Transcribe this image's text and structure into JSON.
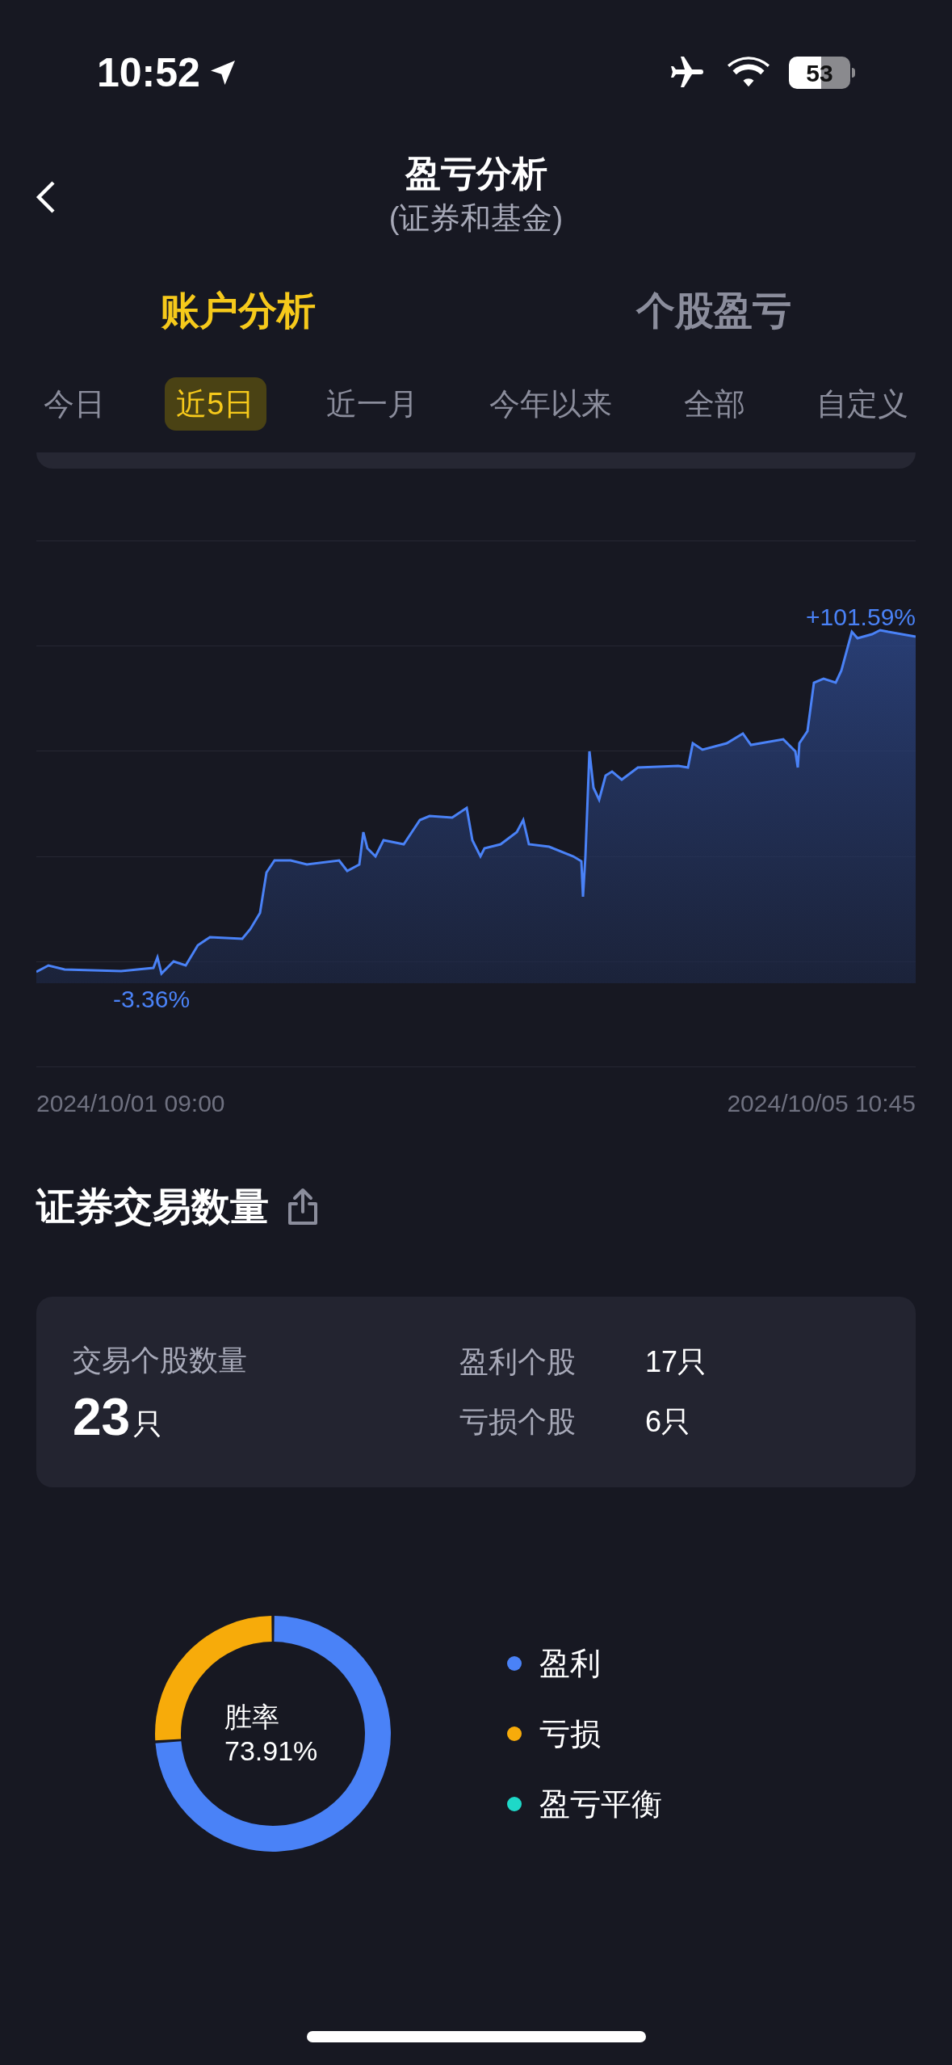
{
  "status_bar": {
    "time": "10:52",
    "battery": "53"
  },
  "header": {
    "title": "盈亏分析",
    "subtitle": "(证券和基金)"
  },
  "tabs": [
    {
      "label": "账户分析",
      "selected": true
    },
    {
      "label": "个股盈亏",
      "selected": false
    }
  ],
  "periods": [
    {
      "label": "今日",
      "selected": false
    },
    {
      "label": "近5日",
      "selected": true
    },
    {
      "label": "近一月",
      "selected": false
    },
    {
      "label": "今年以来",
      "selected": false
    },
    {
      "label": "全部",
      "selected": false
    },
    {
      "label": "自定义",
      "selected": false
    }
  ],
  "return_chart": {
    "max_label": "+101.59%",
    "min_label": "-3.36%",
    "start_date": "2024/10/01 09:00",
    "end_date": "2024/10/05 10:45"
  },
  "trades": {
    "title": "证券交易数量",
    "total_label": "交易个股数量",
    "total_value": "23",
    "total_unit": "只",
    "rows": [
      {
        "label": "盈利个股",
        "value": "17只"
      },
      {
        "label": "亏损个股",
        "value": "6只"
      }
    ]
  },
  "win_rate": {
    "label": "胜率",
    "value": "73.91%",
    "chart_data": {
      "type": "donut",
      "categories": [
        "盈利",
        "亏损",
        "盈亏平衡"
      ],
      "values": [
        73.91,
        26.09,
        0
      ],
      "colors": [
        "#4a82f7",
        "#f7ab0a",
        "#1ed8c8"
      ]
    }
  }
}
